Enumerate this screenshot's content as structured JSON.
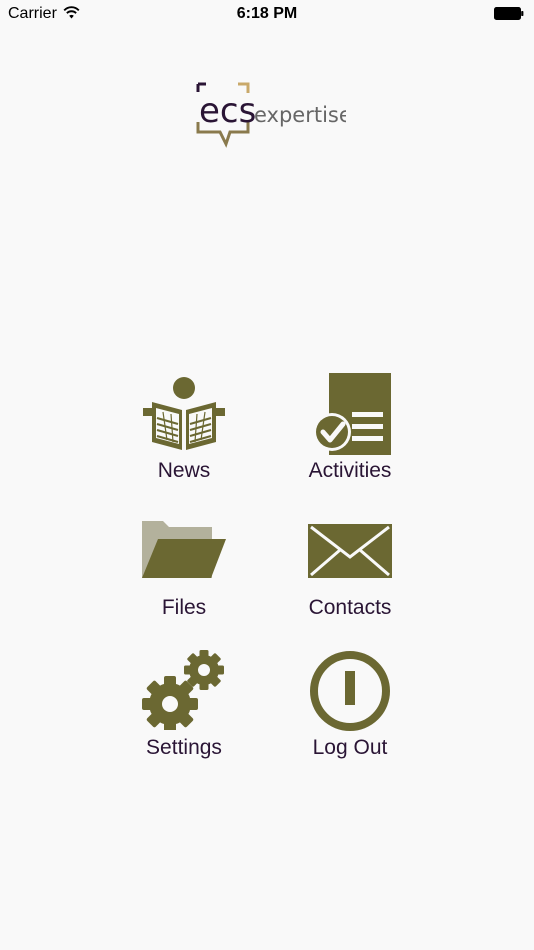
{
  "status_bar": {
    "carrier": "Carrier",
    "time": "6:18 PM"
  },
  "logo": {
    "mark": "ecs",
    "word": "expertise",
    "mark_color": "#2a1535",
    "word_color": "#666666",
    "accent_gold": "#c9a96a",
    "accent_brown": "#8a7a4d"
  },
  "menu": {
    "icon_color": "#6b6832",
    "label_color": "#2a1535",
    "items": [
      {
        "label": "News",
        "icon": "newspaper-reader-icon"
      },
      {
        "label": "Activities",
        "icon": "checklist-document-icon"
      },
      {
        "label": "Files",
        "icon": "folder-icon"
      },
      {
        "label": "Contacts",
        "icon": "envelope-icon"
      },
      {
        "label": "Settings",
        "icon": "gears-icon"
      },
      {
        "label": "Log Out",
        "icon": "power-icon"
      }
    ]
  }
}
